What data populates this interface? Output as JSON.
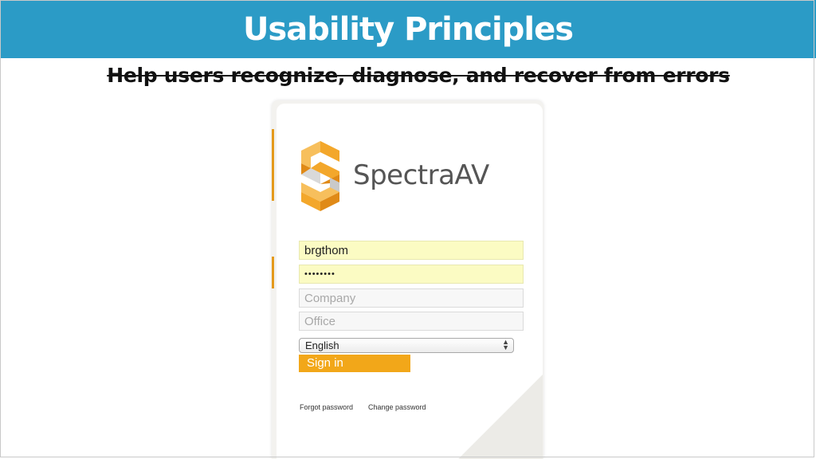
{
  "slide": {
    "title": "Usability Principles",
    "subtitle": "Help users recognize, diagnose, and recover from errors",
    "title_bar_color": "#2b9bc6"
  },
  "login": {
    "brand": "SpectraAV",
    "brand_color": "#555555",
    "logo_icon": "spectra-s-logo",
    "accent_color": "#f2a719",
    "username_value": "brgthom",
    "password_value": "••••••••",
    "company_placeholder": "Company",
    "office_placeholder": "Office",
    "language_selected": "English",
    "signin_label": "Sign in",
    "forgot_password": "Forgot password",
    "change_password": "Change password"
  }
}
